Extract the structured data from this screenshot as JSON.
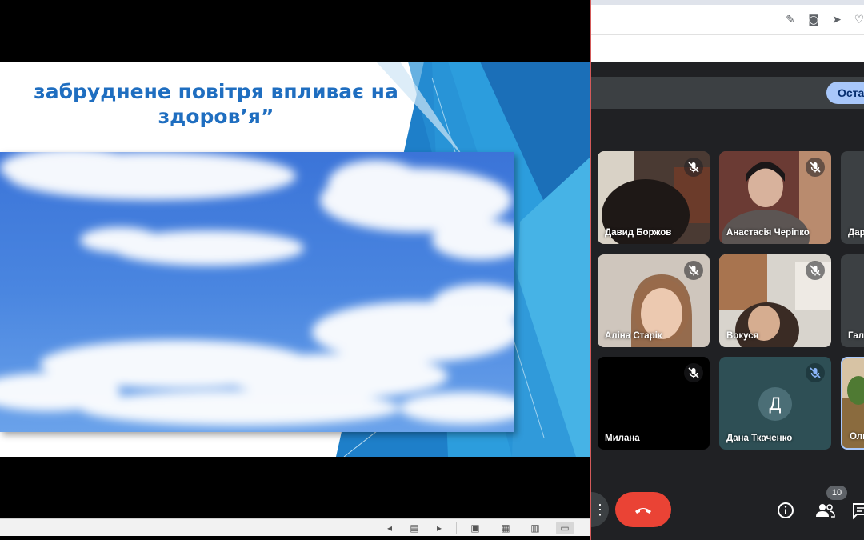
{
  "slide": {
    "title_line1": "забруднене повітря впливає на",
    "title_line2": "здоров’я”"
  },
  "viewer_toolbar": {
    "icons": [
      "prev-slide-icon",
      "notes-icon",
      "next-slide-icon",
      "normal-view-icon",
      "slide-sorter-icon",
      "reading-view-icon",
      "slideshow-icon"
    ]
  },
  "browser": {
    "address_icons": [
      "edit-icon",
      "camera-icon",
      "send-icon",
      "heart-icon"
    ]
  },
  "meet": {
    "stop_button_label": "Оста",
    "participants": [
      {
        "name": "Давид Боржов",
        "muted": true
      },
      {
        "name": "Анастасія Черіпко",
        "muted": true
      },
      {
        "name": "Дар",
        "muted": false
      },
      {
        "name": "Аліна Старік",
        "muted": true
      },
      {
        "name": "Вокуся",
        "muted": true
      },
      {
        "name": "Галі",
        "muted": false
      },
      {
        "name": "Милана",
        "muted": true
      },
      {
        "name": "Дана Ткаченко",
        "muted": true,
        "initial": "Д"
      },
      {
        "name": "Оль",
        "muted": false
      }
    ],
    "people_count": "10",
    "more_label": "⋮"
  },
  "colors": {
    "slide_title": "#1f6ec0",
    "leave_button": "#ea4335",
    "stop_button": "#a8c7fa",
    "meet_bg": "#202124"
  }
}
